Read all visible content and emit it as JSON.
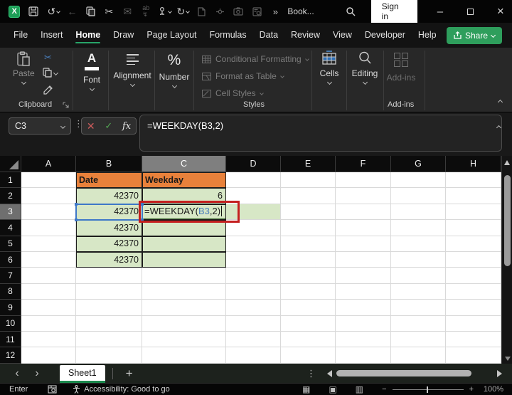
{
  "title_bar": {
    "workbook_title": "Book...",
    "sign_in_label": "Sign in"
  },
  "ribbon_tabs": {
    "tabs": [
      {
        "label": "File"
      },
      {
        "label": "Insert"
      },
      {
        "label": "Home"
      },
      {
        "label": "Draw"
      },
      {
        "label": "Page Layout"
      },
      {
        "label": "Formulas"
      },
      {
        "label": "Data"
      },
      {
        "label": "Review"
      },
      {
        "label": "View"
      },
      {
        "label": "Developer"
      },
      {
        "label": "Help"
      }
    ],
    "active_tab": "Home",
    "share_label": "Share"
  },
  "ribbon": {
    "paste_label": "Paste",
    "clipboard_group_label": "Clipboard",
    "font_glyph": "A",
    "font_label": "Font",
    "alignment_label": "Alignment",
    "number_glyph": "%",
    "number_label": "Number",
    "styles_items": [
      "Conditional Formatting",
      "Format as Table",
      "Cell Styles"
    ],
    "styles_group_label": "Styles",
    "cells_label": "Cells",
    "editing_label": "Editing",
    "addins_label": "Add-ins",
    "addins_group_label": "Add-ins"
  },
  "formula_bar": {
    "name_box_value": "C3",
    "fx_label": "fx",
    "cancel_glyph": "✕",
    "enter_glyph": "✓",
    "formula": "=WEEKDAY(B3,2)"
  },
  "grid": {
    "column_letters": [
      "A",
      "B",
      "C",
      "D",
      "E",
      "F",
      "G",
      "H"
    ],
    "selected_column": "C",
    "selected_row": "3",
    "row_numbers": [
      "1",
      "2",
      "3",
      "4",
      "5",
      "6",
      "7",
      "8",
      "9",
      "10",
      "11",
      "12"
    ],
    "cells": {
      "B1": "Date",
      "C1": "Weekday",
      "B2": "42370",
      "C2": "6",
      "B3": "42370",
      "B4": "42370",
      "B5": "42370",
      "B6": "42370"
    },
    "c3_formula": {
      "pre": "=WEEKDAY(",
      "ref": "B3",
      "post": ",2)"
    }
  },
  "sheet_bar": {
    "sheet_tab_label": "Sheet1",
    "add_sheet_glyph": "+",
    "prev_glyph": "‹",
    "next_glyph": "›",
    "kebab_glyph": "⋮"
  },
  "status_bar": {
    "mode": "Enter",
    "accessibility": "Accessibility: Good to go",
    "normal_view_glyph": "▦",
    "page_layout_glyph": "▣",
    "page_break_glyph": "▥",
    "zoom_out_glyph": "−",
    "zoom_in_glyph": "+",
    "zoom_level": "100%"
  },
  "icons": {
    "cut": "✂",
    "email": "✉",
    "back": "←",
    "undo": "↺",
    "redo": "↻",
    "more": "»",
    "kebab": "⋮",
    "close": "×",
    "minimize": "–"
  },
  "colors": {
    "accent_green": "#27A468",
    "share_green": "#2E9E5C",
    "header_orange": "#E8813B",
    "cell_green": "#D7E7C6",
    "reference_blue": "#3E78C8",
    "annotation_red": "#C41F1F"
  }
}
